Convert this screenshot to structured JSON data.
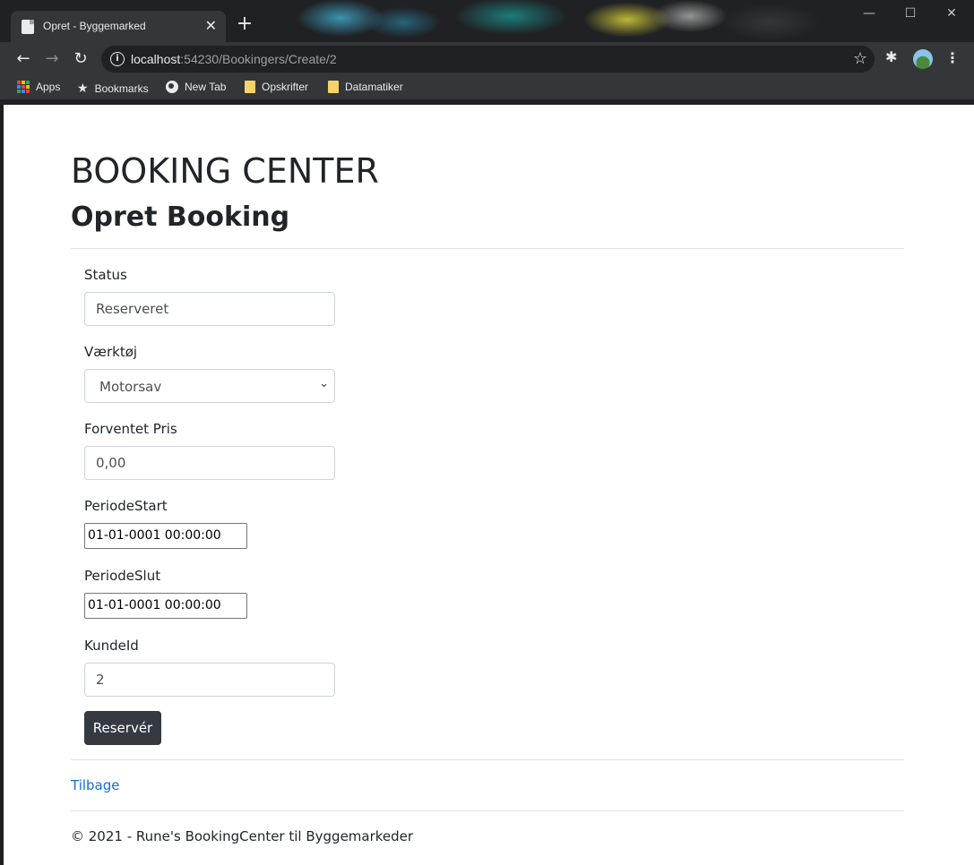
{
  "browser": {
    "tab_title": "Opret - Byggemarked",
    "tab_close": "✕",
    "new_tab": "+",
    "url_host": "localhost",
    "url_rest": ":54230/Bookingers/Create/2",
    "window_controls": {
      "minimize": "—",
      "maximize": "☐",
      "close": "✕"
    },
    "bookmarks": [
      {
        "label": "Apps",
        "icon": "apps-grid-icon"
      },
      {
        "label": "Bookmarks",
        "icon": "star-icon"
      },
      {
        "label": "New Tab",
        "icon": "globe-icon"
      },
      {
        "label": "Opskrifter",
        "icon": "folder-icon"
      },
      {
        "label": "Datamatiker",
        "icon": "folder-icon"
      }
    ]
  },
  "page": {
    "site_title": "BOOKING CENTER",
    "page_title": "Opret Booking",
    "form": {
      "status": {
        "label": "Status",
        "value": "Reserveret"
      },
      "vaerktoej": {
        "label": "Værktøj",
        "value": "Motorsav"
      },
      "pris": {
        "label": "Forventet Pris",
        "value": "0,00"
      },
      "periode_start": {
        "label": "PeriodeStart",
        "value": "01-01-0001 00:00:00"
      },
      "periode_slut": {
        "label": "PeriodeSlut",
        "value": "01-01-0001 00:00:00"
      },
      "kunde_id": {
        "label": "KundeId",
        "value": "2"
      },
      "submit_label": "Reservér"
    },
    "back_link": "Tilbage",
    "footer": "© 2021 - Rune's BookingCenter til Byggemarkeder"
  },
  "colors": {
    "button_bg": "#343a40",
    "link": "#1b6ec2",
    "chrome_dark": "#202124",
    "chrome_toolbar": "#35363a"
  }
}
